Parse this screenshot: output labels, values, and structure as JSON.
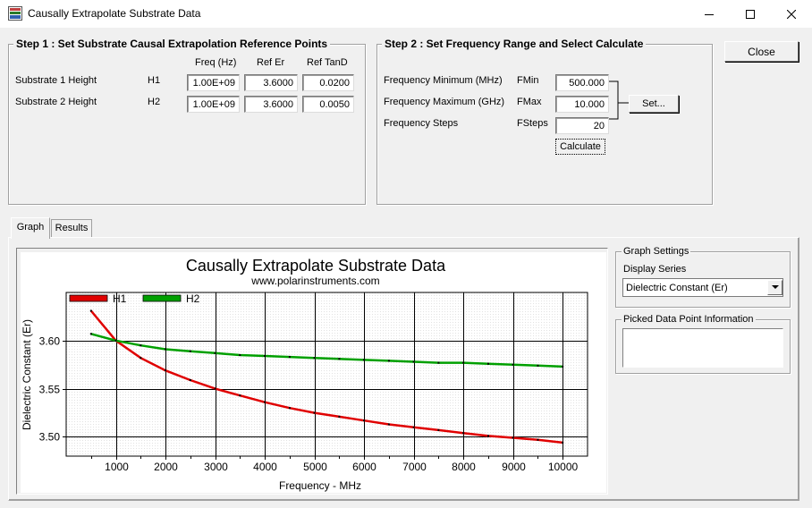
{
  "window": {
    "title": "Causally Extrapolate Substrate Data",
    "icons": {
      "app": "substrate-app-icon",
      "minimize": "minimize-icon",
      "maximize": "maximize-icon",
      "close": "close-icon"
    }
  },
  "step1": {
    "title": "Step 1 : Set Substrate Causal Extrapolation Reference Points",
    "col_headers": [
      "Freq (Hz)",
      "Ref Er",
      "Ref TanD"
    ],
    "rows": [
      {
        "label": "Substrate 1 Height",
        "short": "H1",
        "freq": "1.00E+09",
        "er": "3.6000",
        "tand": "0.0200"
      },
      {
        "label": "Substrate 2 Height",
        "short": "H2",
        "freq": "1.00E+09",
        "er": "3.6000",
        "tand": "0.0050"
      }
    ]
  },
  "step2": {
    "title": "Step 2 : Set Frequency Range and Select Calculate",
    "rows": [
      {
        "label": "Frequency Minimum (MHz)",
        "short": "FMin",
        "value": "500.000"
      },
      {
        "label": "Frequency Maximum (GHz)",
        "short": "FMax",
        "value": "10.000"
      },
      {
        "label": "Frequency Steps",
        "short": "FSteps",
        "value": "20"
      }
    ],
    "set_label": "Set...",
    "calculate_label": "Calculate"
  },
  "close_label": "Close",
  "tabs": [
    "Graph",
    "Results"
  ],
  "graph_settings": {
    "title": "Graph Settings",
    "display_series_label": "Display Series",
    "display_series_value": "Dielectric Constant (Er)",
    "dropdown_icon": "chevron-down-icon"
  },
  "picked": {
    "title": "Picked Data Point Information"
  },
  "chart_data": {
    "type": "line",
    "title": "Causally Extrapolate Substrate Data",
    "subtitle": "www.polarinstruments.com",
    "xlabel": "Frequency - MHz",
    "ylabel": "Dielectric Constant (Er)",
    "xlim": [
      0,
      10500
    ],
    "ylim": [
      3.48,
      3.65
    ],
    "x_ticks": [
      1000,
      2000,
      3000,
      4000,
      5000,
      6000,
      7000,
      8000,
      9000,
      10000
    ],
    "y_ticks": [
      3.5,
      3.55,
      3.6
    ],
    "y_tick_labels": [
      "3.50",
      "3.55",
      "3.60"
    ],
    "grid": true,
    "legend": "top-left",
    "x": [
      500,
      1000,
      1500,
      2000,
      2500,
      3000,
      3500,
      4000,
      4500,
      5000,
      5500,
      6000,
      6500,
      7000,
      7500,
      8000,
      8500,
      9000,
      9500,
      10000
    ],
    "series": [
      {
        "name": "H1",
        "color": "#e00000",
        "values": [
          3.631,
          3.6,
          3.582,
          3.569,
          3.559,
          3.55,
          3.543,
          3.536,
          3.53,
          3.525,
          3.521,
          3.517,
          3.513,
          3.51,
          3.507,
          3.504,
          3.501,
          3.499,
          3.497,
          3.494
        ]
      },
      {
        "name": "H2",
        "color": "#00a000",
        "values": [
          3.607,
          3.6,
          3.595,
          3.591,
          3.589,
          3.587,
          3.585,
          3.584,
          3.583,
          3.582,
          3.581,
          3.58,
          3.579,
          3.578,
          3.577,
          3.577,
          3.576,
          3.575,
          3.574,
          3.573
        ]
      }
    ]
  }
}
